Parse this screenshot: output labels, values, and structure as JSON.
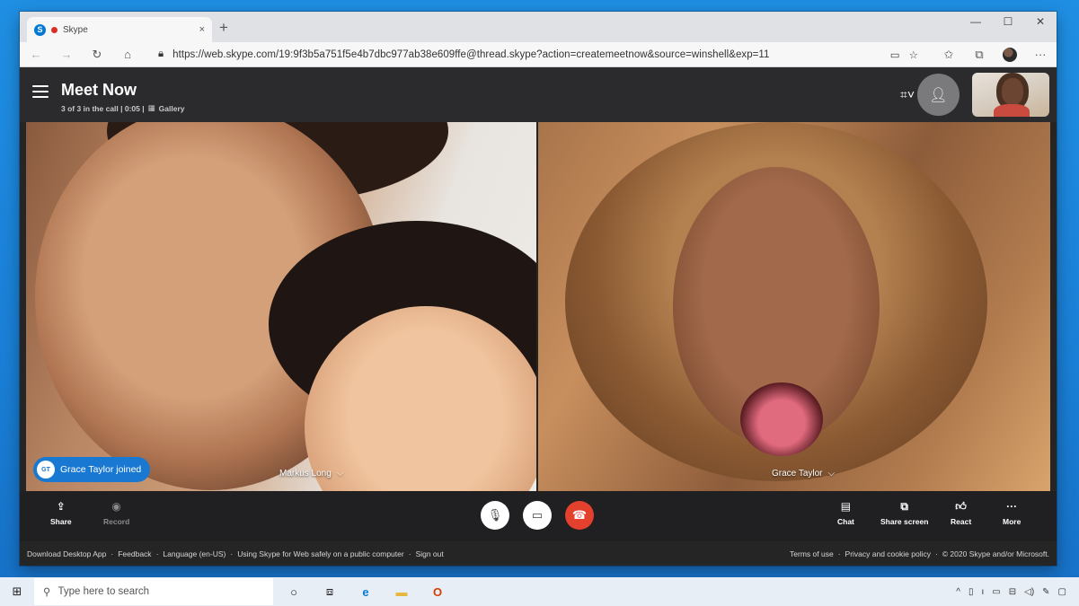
{
  "browser": {
    "tab_title": "Skype",
    "tab_close": "×",
    "new_tab": "+",
    "window_buttons": [
      "—",
      "☐",
      "✕"
    ],
    "address": "https://web.skype.com/19:9f3b5a751f5e4b7dbc977ab38e609ffe@thread.skype?action=createmeetnow&source=winshell&exp=11"
  },
  "header": {
    "title": "Meet Now",
    "call_info": "3 of 3 in the call | 0:05 |",
    "view_mode": "Gallery"
  },
  "tiles": {
    "left_name": "Markus Long",
    "right_name": "Grace Taylor",
    "toast": "Grace Taylor joined",
    "toast_initials": "GT"
  },
  "controls": {
    "share": "Share",
    "record": "Record",
    "chat": "Chat",
    "share_screen": "Share screen",
    "react": "React",
    "more": "More"
  },
  "footer": {
    "left_links": [
      "Download Desktop App",
      "·",
      "Feedback",
      "·",
      "Language (en-US)",
      "·",
      "Using Skype for Web safely on a public computer",
      "·",
      "Sign out"
    ],
    "right_links": [
      "Terms of use",
      "·",
      "Privacy and cookie policy",
      "·",
      "© 2020 Skype and/or Microsoft."
    ]
  },
  "taskbar": {
    "search_placeholder": "Type here to search"
  },
  "colors": {
    "desktop_blue": "#1a7fd6",
    "app_bg": "#252526",
    "end_call_red": "#e3402e",
    "toast_blue": "#1979d2"
  },
  "icons": [
    "windows-start-icon",
    "search-icon",
    "cortana-icon",
    "task-view-icon",
    "edge-icon",
    "file-explorer-icon",
    "office-icon",
    "mic-icon",
    "video-icon",
    "end-call-icon",
    "chat-icon",
    "share-screen-icon",
    "react-icon",
    "more-icon",
    "share-icon",
    "record-icon",
    "add-people-icon",
    "layout-icon",
    "hamburger-icon"
  ]
}
